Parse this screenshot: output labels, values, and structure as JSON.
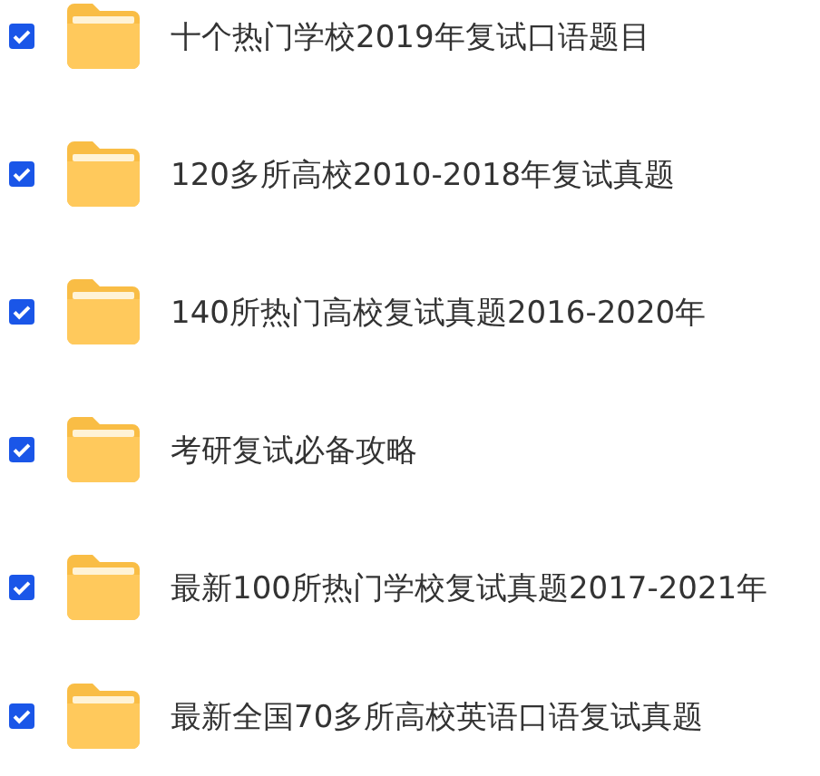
{
  "files": [
    {
      "name": "十个热门学校2019年复试口语题目",
      "checked": true
    },
    {
      "name": "120多所高校2010-2018年复试真题",
      "checked": true
    },
    {
      "name": "140所热门高校复试真题2016-2020年",
      "checked": true
    },
    {
      "name": "考研复试必备攻略",
      "checked": true
    },
    {
      "name": "最新100所热门学校复试真题2017-2021年",
      "checked": true
    },
    {
      "name": "最新全国70多所高校英语口语复试真题",
      "checked": true
    }
  ]
}
